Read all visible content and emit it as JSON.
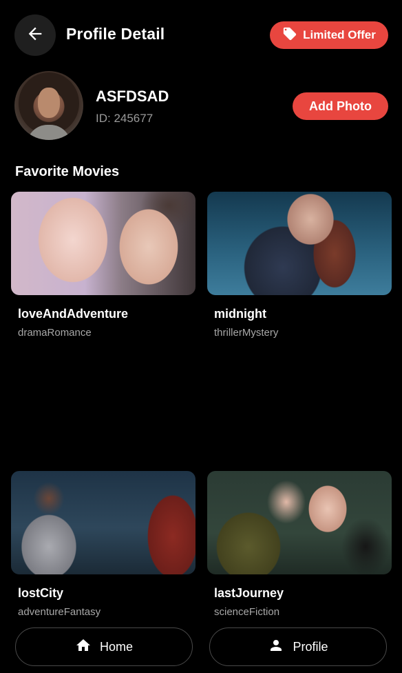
{
  "header": {
    "title": "Profile Detail",
    "offer_label": "Limited Offer",
    "back_icon": "arrow-left-icon",
    "offer_icon": "tag-icon"
  },
  "profile": {
    "name": "ASFDSAD",
    "id_text": "ID: 245677",
    "add_photo_label": "Add Photo"
  },
  "favorites": {
    "title": "Favorite Movies",
    "movies": [
      {
        "title": "loveAndAdventure",
        "genre": "dramaRomance"
      },
      {
        "title": "midnight",
        "genre": "thrillerMystery"
      },
      {
        "title": "lostCity",
        "genre": "adventureFantasy"
      },
      {
        "title": "lastJourney",
        "genre": "scienceFiction"
      }
    ]
  },
  "bottom_nav": {
    "home_label": "Home",
    "profile_label": "Profile",
    "home_icon": "home-icon",
    "profile_icon": "person-icon"
  },
  "colors": {
    "background": "#000000",
    "accent": "#e8463f",
    "secondary_text": "#a8a8a8"
  }
}
